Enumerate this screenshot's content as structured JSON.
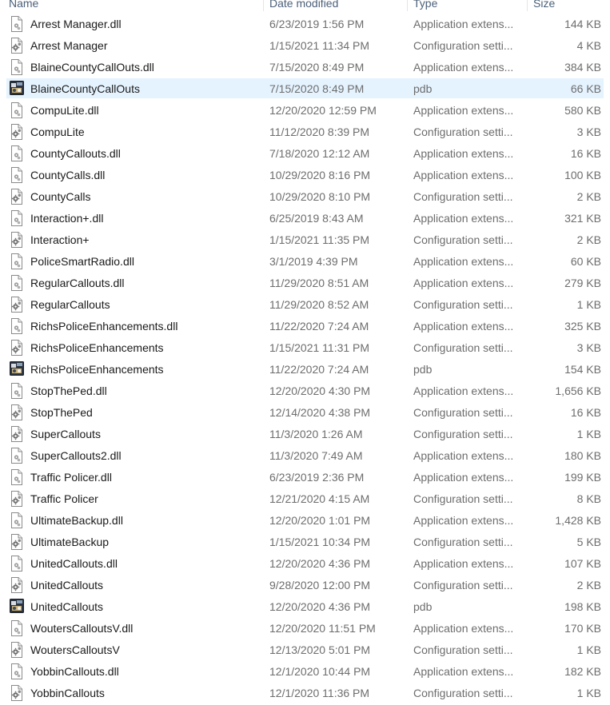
{
  "columns": {
    "name": "Name",
    "date": "Date modified",
    "type": "Type",
    "size": "Size"
  },
  "files": [
    {
      "name": "Arrest Manager.dll",
      "date": "6/23/2019 1:56 PM",
      "type": "Application extens...",
      "size": "144 KB",
      "icon": "dll-icon"
    },
    {
      "name": "Arrest Manager",
      "date": "1/15/2021 11:34 PM",
      "type": "Configuration setti...",
      "size": "4 KB",
      "icon": "config-icon"
    },
    {
      "name": "BlaineCountyCallOuts.dll",
      "date": "7/15/2020 8:49 PM",
      "type": "Application extens...",
      "size": "384 KB",
      "icon": "dll-icon"
    },
    {
      "name": "BlaineCountyCallOuts",
      "date": "7/15/2020 8:49 PM",
      "type": "pdb",
      "size": "66 KB",
      "icon": "pdb-icon",
      "selected": true
    },
    {
      "name": "CompuLite.dll",
      "date": "12/20/2020 12:59 PM",
      "type": "Application extens...",
      "size": "580 KB",
      "icon": "dll-icon"
    },
    {
      "name": "CompuLite",
      "date": "11/12/2020 8:39 PM",
      "type": "Configuration setti...",
      "size": "3 KB",
      "icon": "config-icon"
    },
    {
      "name": "CountyCallouts.dll",
      "date": "7/18/2020 12:12 AM",
      "type": "Application extens...",
      "size": "16 KB",
      "icon": "dll-icon"
    },
    {
      "name": "CountyCalls.dll",
      "date": "10/29/2020 8:16 PM",
      "type": "Application extens...",
      "size": "100 KB",
      "icon": "dll-icon"
    },
    {
      "name": "CountyCalls",
      "date": "10/29/2020 8:10 PM",
      "type": "Configuration setti...",
      "size": "2 KB",
      "icon": "config-icon"
    },
    {
      "name": "Interaction+.dll",
      "date": "6/25/2019 8:43 AM",
      "type": "Application extens...",
      "size": "321 KB",
      "icon": "dll-icon"
    },
    {
      "name": "Interaction+",
      "date": "1/15/2021 11:35 PM",
      "type": "Configuration setti...",
      "size": "2 KB",
      "icon": "config-icon"
    },
    {
      "name": "PoliceSmartRadio.dll",
      "date": "3/1/2019 4:39 PM",
      "type": "Application extens...",
      "size": "60 KB",
      "icon": "dll-icon"
    },
    {
      "name": "RegularCallouts.dll",
      "date": "11/29/2020 8:51 AM",
      "type": "Application extens...",
      "size": "279 KB",
      "icon": "dll-icon"
    },
    {
      "name": "RegularCallouts",
      "date": "11/29/2020 8:52 AM",
      "type": "Configuration setti...",
      "size": "1 KB",
      "icon": "config-icon"
    },
    {
      "name": "RichsPoliceEnhancements.dll",
      "date": "11/22/2020 7:24 AM",
      "type": "Application extens...",
      "size": "325 KB",
      "icon": "dll-icon"
    },
    {
      "name": "RichsPoliceEnhancements",
      "date": "1/15/2021 11:31 PM",
      "type": "Configuration setti...",
      "size": "3 KB",
      "icon": "config-icon"
    },
    {
      "name": "RichsPoliceEnhancements",
      "date": "11/22/2020 7:24 AM",
      "type": "pdb",
      "size": "154 KB",
      "icon": "pdb-icon"
    },
    {
      "name": "StopThePed.dll",
      "date": "12/20/2020 4:30 PM",
      "type": "Application extens...",
      "size": "1,656 KB",
      "icon": "dll-icon"
    },
    {
      "name": "StopThePed",
      "date": "12/14/2020 4:38 PM",
      "type": "Configuration setti...",
      "size": "16 KB",
      "icon": "config-icon"
    },
    {
      "name": "SuperCallouts",
      "date": "11/3/2020 1:26 AM",
      "type": "Configuration setti...",
      "size": "1 KB",
      "icon": "config-icon"
    },
    {
      "name": "SuperCallouts2.dll",
      "date": "11/3/2020 7:49 AM",
      "type": "Application extens...",
      "size": "180 KB",
      "icon": "dll-icon"
    },
    {
      "name": "Traffic Policer.dll",
      "date": "6/23/2019 2:36 PM",
      "type": "Application extens...",
      "size": "199 KB",
      "icon": "dll-icon"
    },
    {
      "name": "Traffic Policer",
      "date": "12/21/2020 4:15 AM",
      "type": "Configuration setti...",
      "size": "8 KB",
      "icon": "config-icon"
    },
    {
      "name": "UltimateBackup.dll",
      "date": "12/20/2020 1:01 PM",
      "type": "Application extens...",
      "size": "1,428 KB",
      "icon": "dll-icon"
    },
    {
      "name": "UltimateBackup",
      "date": "1/15/2021 10:34 PM",
      "type": "Configuration setti...",
      "size": "5 KB",
      "icon": "config-icon"
    },
    {
      "name": "UnitedCallouts.dll",
      "date": "12/20/2020 4:36 PM",
      "type": "Application extens...",
      "size": "107 KB",
      "icon": "dll-icon"
    },
    {
      "name": "UnitedCallouts",
      "date": "9/28/2020 12:00 PM",
      "type": "Configuration setti...",
      "size": "2 KB",
      "icon": "config-icon"
    },
    {
      "name": "UnitedCallouts",
      "date": "12/20/2020 4:36 PM",
      "type": "pdb",
      "size": "198 KB",
      "icon": "pdb-icon"
    },
    {
      "name": "WoutersCalloutsV.dll",
      "date": "12/20/2020 11:51 PM",
      "type": "Application extens...",
      "size": "170 KB",
      "icon": "dll-icon"
    },
    {
      "name": "WoutersCalloutsV",
      "date": "12/13/2020 5:01 PM",
      "type": "Configuration setti...",
      "size": "1 KB",
      "icon": "config-icon"
    },
    {
      "name": "YobbinCallouts.dll",
      "date": "12/1/2020 10:44 PM",
      "type": "Application extens...",
      "size": "182 KB",
      "icon": "dll-icon"
    },
    {
      "name": "YobbinCallouts",
      "date": "12/1/2020 11:36 PM",
      "type": "Configuration setti...",
      "size": "1 KB",
      "icon": "config-icon"
    }
  ],
  "colors": {
    "selection": "#e5f3ff",
    "header_text": "#4c607a",
    "secondary_text": "#6d6d6d"
  }
}
